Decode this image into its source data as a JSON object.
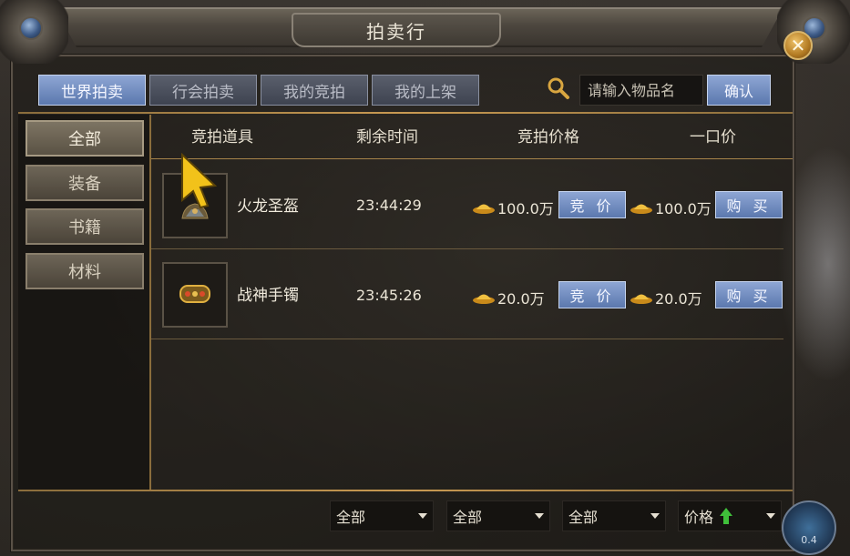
{
  "window": {
    "title": "拍卖行",
    "close_symbol": "✕"
  },
  "tabs": [
    {
      "label": "世界拍卖",
      "active": true
    },
    {
      "label": "行会拍卖",
      "active": false
    },
    {
      "label": "我的竞拍",
      "active": false
    },
    {
      "label": "我的上架",
      "active": false
    }
  ],
  "search": {
    "placeholder": "请输入物品名",
    "confirm_label": "确认"
  },
  "categories": [
    {
      "label": "全部",
      "active": true
    },
    {
      "label": "装备",
      "active": false
    },
    {
      "label": "书籍",
      "active": false
    },
    {
      "label": "材料",
      "active": false
    }
  ],
  "table": {
    "headers": {
      "item": "竞拍道具",
      "time": "剩余时间",
      "bid_price": "竞拍价格",
      "buyout": "一口价"
    },
    "rows": [
      {
        "name": "火龙圣盔",
        "time": "23:44:29",
        "bid_price": "100.0万",
        "bid_label": "竞 价",
        "buyout_price": "100.0万",
        "buy_label": "购 买",
        "icon": "helmet-icon"
      },
      {
        "name": "战神手镯",
        "time": "23:45:26",
        "bid_price": "20.0万",
        "bid_label": "竞 价",
        "buyout_price": "20.0万",
        "buy_label": "购 买",
        "icon": "bracelet-icon"
      }
    ]
  },
  "filters": [
    {
      "value": "全部"
    },
    {
      "value": "全部"
    },
    {
      "value": "全部"
    },
    {
      "value": "价格",
      "sort": "ascending"
    }
  ],
  "minimap": {
    "label": "0.4"
  },
  "colors": {
    "accent_blue": "#5b78ae",
    "gold_rule": "#c99a52",
    "sort_arrow": "#3fbf3a"
  }
}
